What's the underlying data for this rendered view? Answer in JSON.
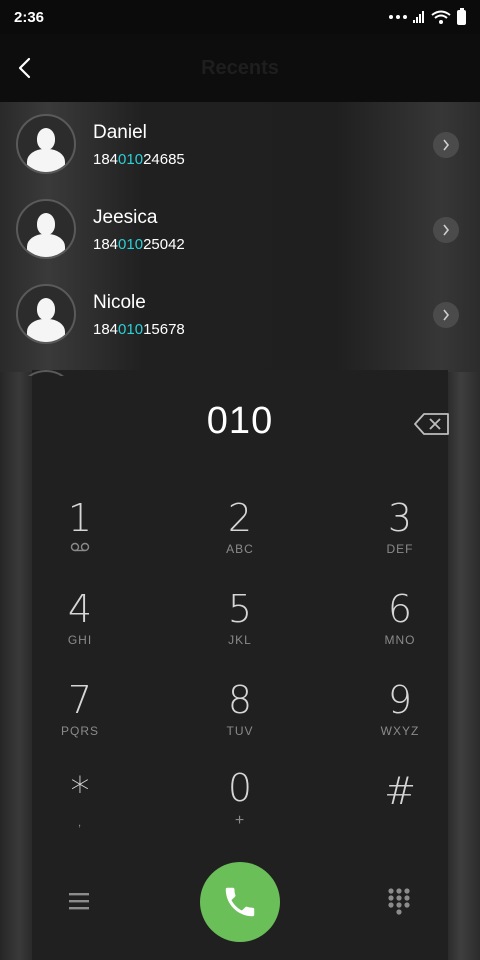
{
  "status_bar": {
    "time": "2:36"
  },
  "app_bar": {
    "title": "Recents"
  },
  "contacts": [
    {
      "name": "Daniel",
      "number_prefix": "184",
      "number_match": "010",
      "number_suffix": "24685"
    },
    {
      "name": "Jeesica",
      "number_prefix": "184",
      "number_match": "010",
      "number_suffix": "25042"
    },
    {
      "name": "Nicole",
      "number_prefix": "184",
      "number_match": "010",
      "number_suffix": "15678"
    }
  ],
  "dialer": {
    "entered_number": "010",
    "keys": [
      {
        "digit": "1",
        "letters": ""
      },
      {
        "digit": "2",
        "letters": "ABC"
      },
      {
        "digit": "3",
        "letters": "DEF"
      },
      {
        "digit": "4",
        "letters": "GHI"
      },
      {
        "digit": "5",
        "letters": "JKL"
      },
      {
        "digit": "6",
        "letters": "MNO"
      },
      {
        "digit": "7",
        "letters": "PQRS"
      },
      {
        "digit": "8",
        "letters": "TUV"
      },
      {
        "digit": "9",
        "letters": "WXYZ"
      },
      {
        "digit": "*",
        "letters": ","
      },
      {
        "digit": "0",
        "letters": "+"
      },
      {
        "digit": "#",
        "letters": ""
      }
    ]
  },
  "colors": {
    "accent_match": "#2ad1d8",
    "call_button": "#6abf58"
  },
  "icons": [
    "back-arrow-icon",
    "chevron-right-icon",
    "backspace-icon",
    "voicemail-icon",
    "menu-icon",
    "phone-icon",
    "keypad-icon"
  ]
}
